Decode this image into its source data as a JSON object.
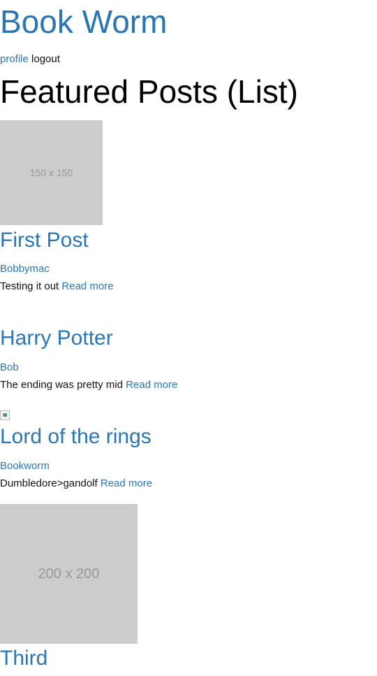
{
  "site": {
    "title": "Book Worm"
  },
  "nav": {
    "profile": "profile",
    "logout": "logout"
  },
  "page": {
    "title": "Featured Posts (List)"
  },
  "read_more": "Read more",
  "posts": [
    {
      "title": "First Post",
      "author": "Bobbymac",
      "excerpt": "Testing it out",
      "image": "150 x 150"
    },
    {
      "title": "Harry Potter",
      "author": "Bob",
      "excerpt": "The ending was pretty mid"
    },
    {
      "title": "Lord of the rings",
      "author": "Bookworm",
      "excerpt": "Dumbledore>gandolf"
    },
    {
      "title": "Third",
      "image": "200 x 200"
    }
  ]
}
